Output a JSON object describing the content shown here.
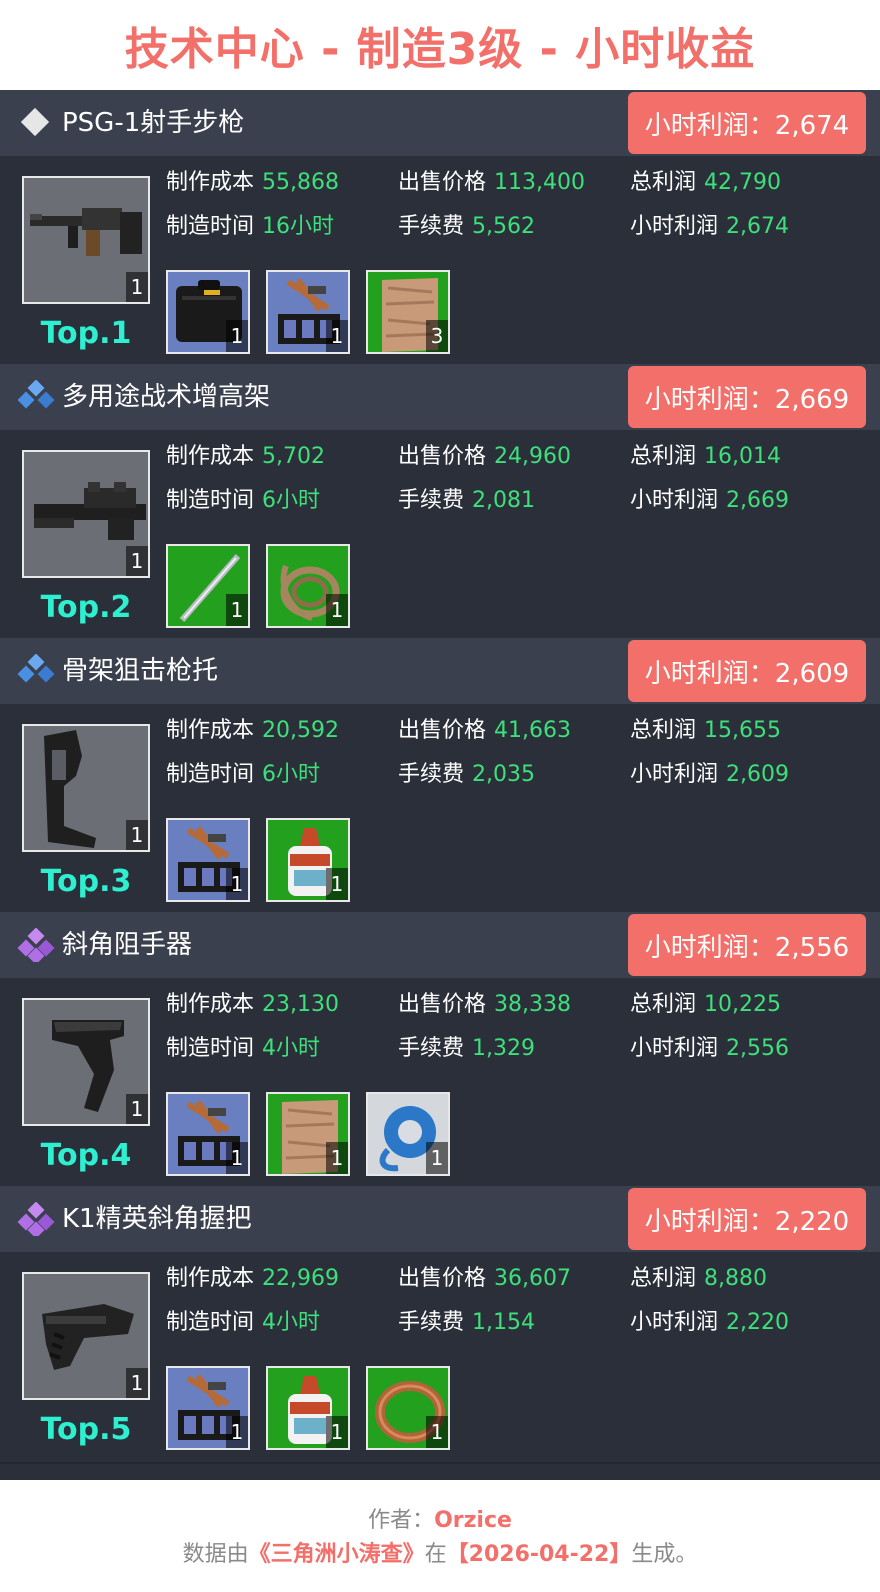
{
  "title": "技术中心 - 制造3级 - 小时收益",
  "labels": {
    "cost": "制作成本",
    "price": "出售价格",
    "total_profit": "总利润",
    "time": "制造时间",
    "fee": "手续费",
    "hourly_profit": "小时利润"
  },
  "colors": {
    "accent": "#f26f6a",
    "value_green": "#3de07a",
    "rank_cyan": "#2ef0d0",
    "card_bg": "#2b2f3a",
    "header_bg": "#3a404d",
    "rarity_white": "#e6e6e6",
    "rarity_blue": "#4a90e2",
    "rarity_purple": "#b06fe6"
  },
  "items": [
    {
      "name": "PSG-1射手步枪",
      "rarity": "white",
      "rarity_icon": "diamond-rarity-icon",
      "profit_badge": "小时利润：2,674",
      "icon": "rifle-icon",
      "qty": "1",
      "rank": "Top.1",
      "cost": "55,868",
      "price": "113,400",
      "total_profit": "42,790",
      "time": "16小时",
      "fee": "5,562",
      "hourly_profit": "2,674",
      "materials": [
        {
          "icon": "weapon-case-icon",
          "bg": "blue",
          "qty": "1"
        },
        {
          "icon": "tool-kit-icon",
          "bg": "blue",
          "qty": "1"
        },
        {
          "icon": "wood-plank-icon",
          "bg": "green",
          "qty": "3"
        }
      ]
    },
    {
      "name": "多用途战术增高架",
      "rarity": "blue",
      "rarity_icon": "diamond-cluster-rarity-icon",
      "profit_badge": "小时利润：2,669",
      "icon": "riser-mount-icon",
      "qty": "1",
      "rank": "Top.2",
      "cost": "5,702",
      "price": "24,960",
      "total_profit": "16,014",
      "time": "6小时",
      "fee": "2,081",
      "hourly_profit": "2,669",
      "materials": [
        {
          "icon": "metal-rod-icon",
          "bg": "green",
          "qty": "1"
        },
        {
          "icon": "hose-coil-icon",
          "bg": "green",
          "qty": "1"
        }
      ]
    },
    {
      "name": "骨架狙击枪托",
      "rarity": "blue",
      "rarity_icon": "diamond-cluster-rarity-icon",
      "profit_badge": "小时利润：2,609",
      "icon": "skeleton-stock-icon",
      "qty": "1",
      "rank": "Top.3",
      "cost": "20,592",
      "price": "41,663",
      "total_profit": "15,655",
      "time": "6小时",
      "fee": "2,035",
      "hourly_profit": "2,609",
      "materials": [
        {
          "icon": "tool-kit-icon",
          "bg": "blue",
          "qty": "1"
        },
        {
          "icon": "glue-bottle-icon",
          "bg": "green",
          "qty": "1"
        }
      ]
    },
    {
      "name": "斜角阻手器",
      "rarity": "purple",
      "rarity_icon": "diamond-cluster-rarity-icon",
      "profit_badge": "小时利润：2,556",
      "icon": "angled-handstop-icon",
      "qty": "1",
      "rank": "Top.4",
      "cost": "23,130",
      "price": "38,338",
      "total_profit": "10,225",
      "time": "4小时",
      "fee": "1,329",
      "hourly_profit": "2,556",
      "materials": [
        {
          "icon": "tool-kit-icon",
          "bg": "blue",
          "qty": "1"
        },
        {
          "icon": "wood-plank-icon",
          "bg": "green",
          "qty": "1"
        },
        {
          "icon": "tape-roll-icon",
          "bg": "grey",
          "qty": "1"
        }
      ]
    },
    {
      "name": "K1精英斜角握把",
      "rarity": "purple",
      "rarity_icon": "diamond-cluster-rarity-icon",
      "profit_badge": "小时利润：2,220",
      "icon": "angled-grip-icon",
      "qty": "1",
      "rank": "Top.5",
      "cost": "22,969",
      "price": "36,607",
      "total_profit": "8,880",
      "time": "4小时",
      "fee": "1,154",
      "hourly_profit": "2,220",
      "materials": [
        {
          "icon": "tool-kit-icon",
          "bg": "blue",
          "qty": "1"
        },
        {
          "icon": "glue-bottle-icon",
          "bg": "green",
          "qty": "1"
        },
        {
          "icon": "copper-wire-icon",
          "bg": "green",
          "qty": "1"
        }
      ]
    }
  ],
  "footer": {
    "author_label": "作者：",
    "author": "Orzice",
    "line2_prefix": "数据由",
    "source": "《三角洲小涛查》",
    "line2_mid": "在",
    "date": "【2026-04-22】",
    "line2_suffix": "生成。"
  }
}
